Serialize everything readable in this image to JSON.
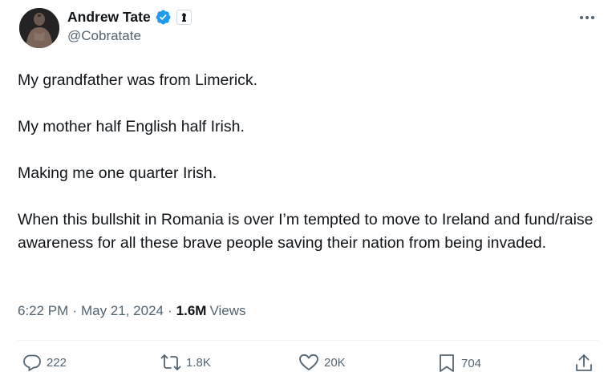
{
  "author": {
    "display_name": "Andrew Tate",
    "handle": "@Cobratate",
    "verified_color": "#1d9bf0"
  },
  "tweet": {
    "paragraphs": [
      "My grandfather was from Limerick.",
      "My mother half English half Irish.",
      "Making me one quarter Irish.",
      "When this bullshit in Romania is over I’m tempted to move to Ireland and fund/raise awareness for all these brave people saving their nation from being invaded."
    ],
    "time": "6:22 PM",
    "date": "May 21, 2024",
    "separator": "·",
    "views_count": "1.6M",
    "views_label": "Views"
  },
  "actions": {
    "replies": "222",
    "reposts": "1.8K",
    "likes": "20K",
    "bookmarks": "704"
  },
  "icons": {
    "reply": "reply-icon",
    "repost": "repost-icon",
    "like": "like-icon",
    "bookmark": "bookmark-icon",
    "share": "share-icon",
    "more": "more-icon",
    "verified": "verified-icon",
    "affiliate": "affiliate-badge-icon"
  },
  "colors": {
    "text_primary": "#0f1419",
    "text_secondary": "#536471",
    "verified_blue": "#1d9bf0"
  }
}
